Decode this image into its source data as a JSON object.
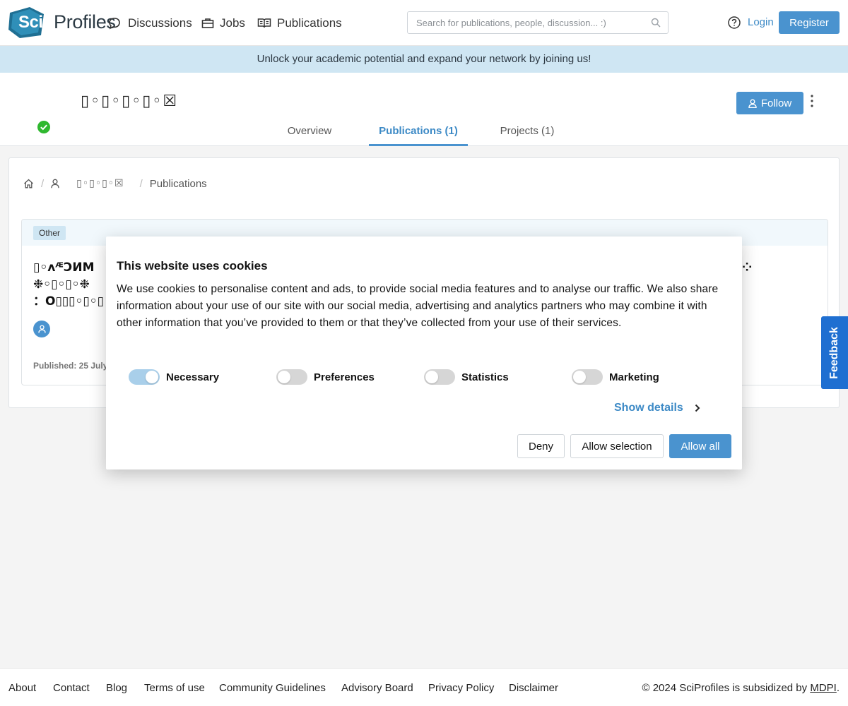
{
  "header": {
    "logo_sci": "Sci",
    "logo_profiles": "Profiles",
    "nav": [
      {
        "label": "Discussions",
        "icon": "chat-bubble-icon"
      },
      {
        "label": "Jobs",
        "icon": "briefcase-icon"
      },
      {
        "label": "Publications",
        "icon": "open-book-icon"
      }
    ],
    "search_placeholder": "Search for publications, people, discussion... :)",
    "login": "Login",
    "register": "Register"
  },
  "banner": "Unlock your academic potential and expand your network by joining us!",
  "profile": {
    "name": "▯◦▯◦▯◦▯◦☒",
    "follow": "Follow",
    "tabs": [
      {
        "label": "Overview",
        "active": false
      },
      {
        "label": "Publications (1)",
        "active": true
      },
      {
        "label": "Projects (1)",
        "active": false
      }
    ]
  },
  "breadcrumb": {
    "name": "▯◦▯◦▯◦☒",
    "current": "Publications"
  },
  "publication": {
    "type": "Other",
    "title_line1": "▯◦ᴧᴭƆИΜ",
    "title_line1_end": "⁘",
    "title_line2": "❉◦▯◦▯◦❉",
    "title_line3": "：Ο▯▯▯◦▯◦▯",
    "published": "Published: 25 July"
  },
  "cookie": {
    "title": "This website uses cookies",
    "text": "We use cookies to personalise content and ads, to provide social media features and to analyse our traffic. We also share information about your use of our site with our social media, advertising and analytics partners who may combine it with other information that you’ve provided to them or that they’ve collected from your use of their services.",
    "toggles": [
      {
        "label": "Necessary",
        "on": true
      },
      {
        "label": "Preferences",
        "on": false
      },
      {
        "label": "Statistics",
        "on": false
      },
      {
        "label": "Marketing",
        "on": false
      }
    ],
    "show_details": "Show details",
    "deny": "Deny",
    "allow_selection": "Allow selection",
    "allow_all": "Allow all"
  },
  "feedback": "Feedback",
  "footer": {
    "links": [
      "About",
      "Contact",
      "Blog",
      "Terms of use",
      "Community Guidelines",
      "Advisory Board",
      "Privacy Policy",
      "Disclaimer"
    ],
    "copyright_prefix": "© 2024 SciProfiles is subsidized by ",
    "copyright_link": "MDPI",
    "copyright_suffix": "."
  },
  "colors": {
    "accent": "#4a93cf",
    "banner": "#cfe6f3",
    "feedback": "#1f6fd1",
    "verified": "#2fb82f"
  }
}
